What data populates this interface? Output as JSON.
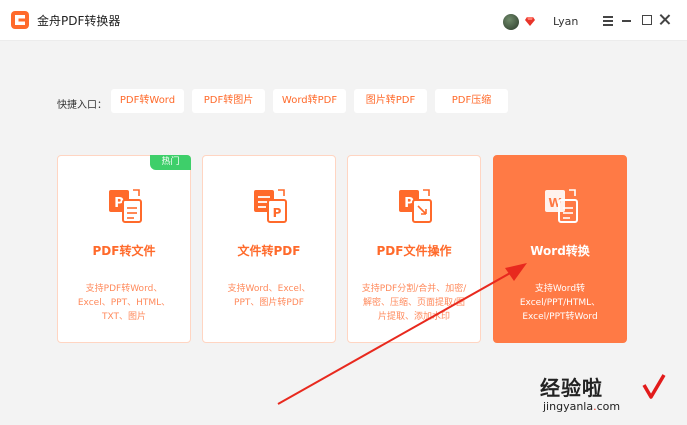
{
  "app": {
    "title": "金舟PDF转换器"
  },
  "user": {
    "name": "Lyan"
  },
  "quick_access": {
    "label": "快捷入口：",
    "items": [
      {
        "label": "PDF转Word"
      },
      {
        "label": "PDF转图片"
      },
      {
        "label": "Word转PDF"
      },
      {
        "label": "图片转PDF"
      },
      {
        "label": "PDF压缩"
      }
    ]
  },
  "cards": [
    {
      "title": "PDF转文件",
      "desc": "支持PDF转Word、Excel、PPT、HTML、TXT、图片",
      "badge": "热门",
      "icon": "pdf-to-file-icon"
    },
    {
      "title": "文件转PDF",
      "desc": "支持Word、Excel、PPT、图片转PDF",
      "icon": "file-to-pdf-icon"
    },
    {
      "title": "PDF文件操作",
      "desc": "支持PDF分割/合并、加密/解密、压缩、页面提取/图片提取、添加水印",
      "icon": "pdf-operation-icon"
    },
    {
      "title": "Word转换",
      "desc": "支持Word转Excel/PPT/HTML、Excel/PPT转Word",
      "icon": "word-convert-icon",
      "active": true
    }
  ],
  "watermark": {
    "main": "经验啦",
    "domain_prefix": "jingyanla",
    "domain_dot": ".",
    "domain_suffix": "com"
  },
  "colors": {
    "accent": "#ff6a2b",
    "active_card": "#ff7a45",
    "badge": "#3ecf6a",
    "arrow": "#e8291e"
  }
}
